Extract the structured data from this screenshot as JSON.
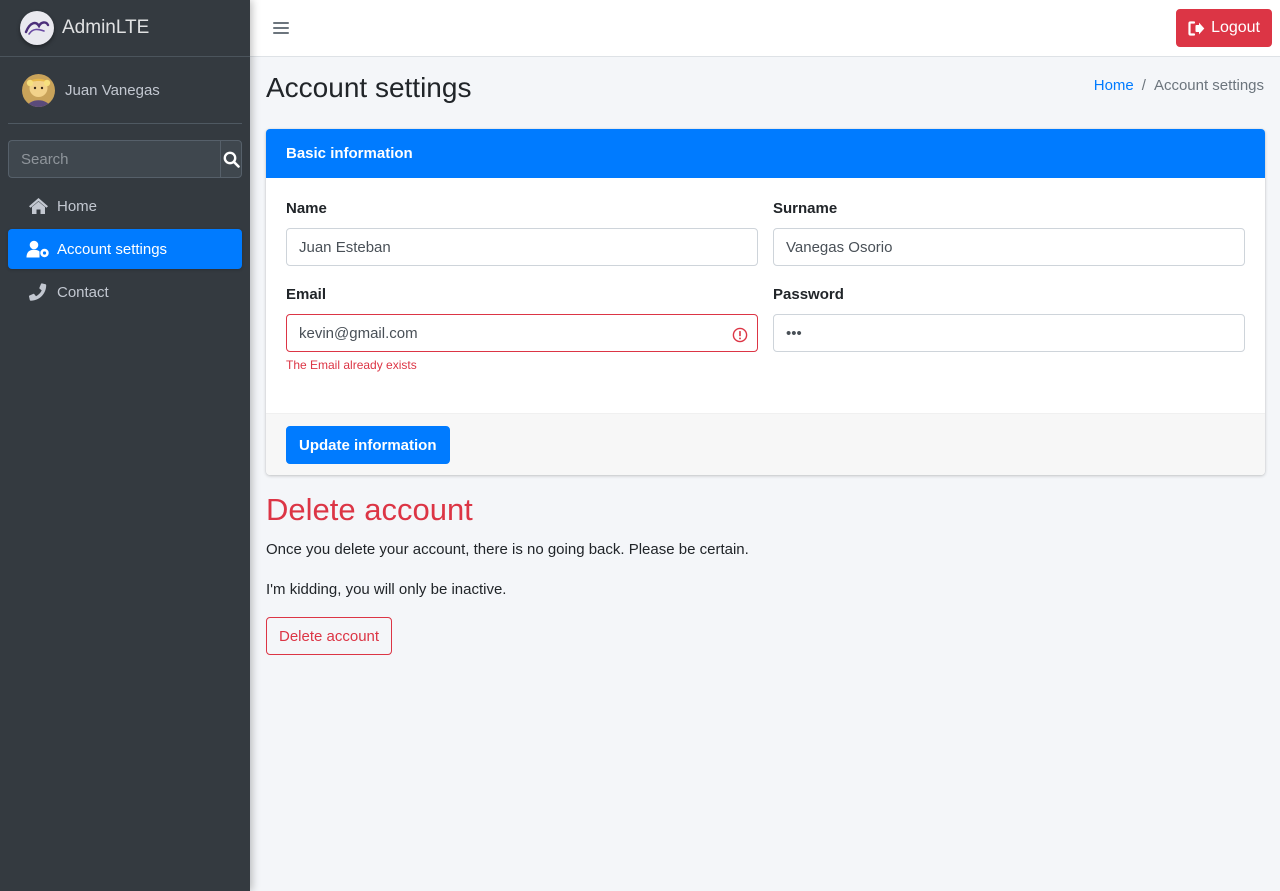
{
  "brand": {
    "name": "AdminLTE",
    "logo_icon": "jojo-logo-icon"
  },
  "user": {
    "name": "Juan Vanegas",
    "avatar_icon": "user-avatar-icon"
  },
  "sidebar": {
    "search_placeholder": "Search",
    "items": [
      {
        "label": "Home",
        "icon": "home-icon",
        "active": false
      },
      {
        "label": "Account settings",
        "icon": "user-cog-icon",
        "active": true
      },
      {
        "label": "Contact",
        "icon": "phone-icon",
        "active": false
      }
    ]
  },
  "navbar": {
    "logout_label": "Logout"
  },
  "page": {
    "title": "Account settings",
    "breadcrumb": {
      "home": "Home",
      "separator": "/",
      "current": "Account settings"
    }
  },
  "basic_info": {
    "header": "Basic information",
    "name": {
      "label": "Name",
      "value": "Juan Esteban"
    },
    "surname": {
      "label": "Surname",
      "value": "Vanegas Osorio"
    },
    "email": {
      "label": "Email",
      "value": "kevin@gmail.com",
      "error": "The Email already exists"
    },
    "password": {
      "label": "Password",
      "value": "•••"
    },
    "submit_label": "Update information"
  },
  "delete_section": {
    "title": "Delete account",
    "text1": "Once you delete your account, there is no going back. Please be certain.",
    "text2": "I'm kidding, you will only be inactive.",
    "button_label": "Delete account"
  },
  "colors": {
    "primary": "#007bff",
    "danger": "#dc3545",
    "sidebar": "#343a40"
  }
}
